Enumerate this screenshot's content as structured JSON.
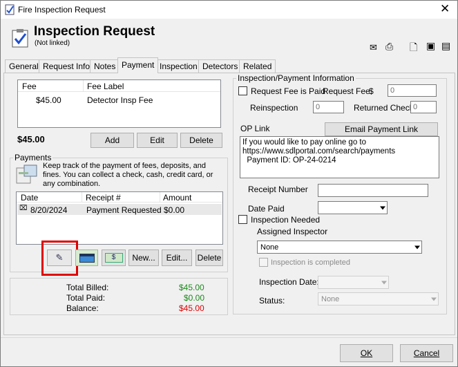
{
  "window": {
    "title": "Fire Inspection Request"
  },
  "header": {
    "title": "Inspection Request",
    "subtitle": "(Not linked)"
  },
  "tabs": [
    "General",
    "Request Info",
    "Notes",
    "Payment",
    "Inspection",
    "Detectors",
    "Related"
  ],
  "fees": {
    "columns": [
      "Fee",
      "Fee Label"
    ],
    "rows": [
      {
        "fee": "$45.00",
        "label": "Detector Insp Fee"
      }
    ],
    "total": "$45.00",
    "add": "Add",
    "edit": "Edit",
    "delete": "Delete"
  },
  "payments": {
    "group_label": "Payments",
    "info": "Keep track of the payment of fees, deposits, and fines. You can collect a check, cash, credit card, or any combination.",
    "columns": [
      "Date",
      "Receipt #",
      "Amount"
    ],
    "rows": [
      {
        "date": "8/20/2024",
        "receipt": "Payment Requested",
        "amount": "$0.00"
      }
    ],
    "new": "New...",
    "edit": "Edit...",
    "delete": "Delete"
  },
  "totals": {
    "billed_label": "Total Billed:",
    "billed": "$45.00",
    "paid_label": "Total Paid:",
    "paid": "$0.00",
    "balance_label": "Balance:",
    "balance": "$45.00",
    "billed_color": "#1a8a1a",
    "paid_color": "#1a8a1a",
    "balance_color": "#e00000"
  },
  "info": {
    "group_label": "Inspection/Payment Information",
    "request_fee_paid": "Request Fee is Paid",
    "request_fee_label": "Request Fee",
    "currency": "$",
    "request_fee": "0",
    "reinspection_label": "Reinspection",
    "reinspection": "0",
    "returned_check_label": "Returned Check",
    "returned_check": "0",
    "op_link_label": "OP Link",
    "email_btn": "Email Payment Link",
    "op_text": "If you would like to pay online go to\nhttps://www.sdlportal.com/search/payments\n  Payment ID: OP-24-0214",
    "receipt_number_label": "Receipt Number",
    "date_paid_label": "Date Paid",
    "inspection_needed": "Inspection Needed",
    "assigned_inspector_label": "Assigned Inspector",
    "assigned_inspector": "None",
    "inspection_completed": "Inspection is completed",
    "inspection_date_label": "Inspection Date:",
    "status_label": "Status:",
    "status": "None"
  },
  "footer": {
    "ok": "OK",
    "cancel": "Cancel"
  },
  "colors": {
    "highlight": "#e00000"
  }
}
